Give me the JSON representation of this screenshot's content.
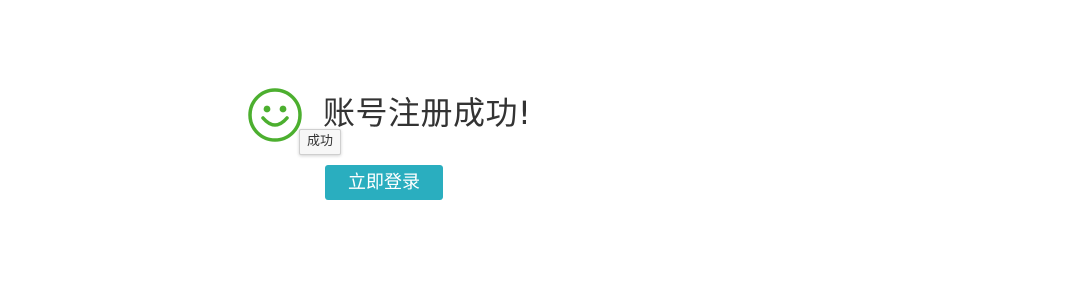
{
  "message": {
    "title": "账号注册成功!",
    "tooltip": "成功",
    "icon": "smile-icon"
  },
  "actions": {
    "login_label": "立即登录"
  },
  "colors": {
    "success_green": "#4caf2f",
    "button_teal": "#2aaebf",
    "text_dark": "#333333"
  }
}
